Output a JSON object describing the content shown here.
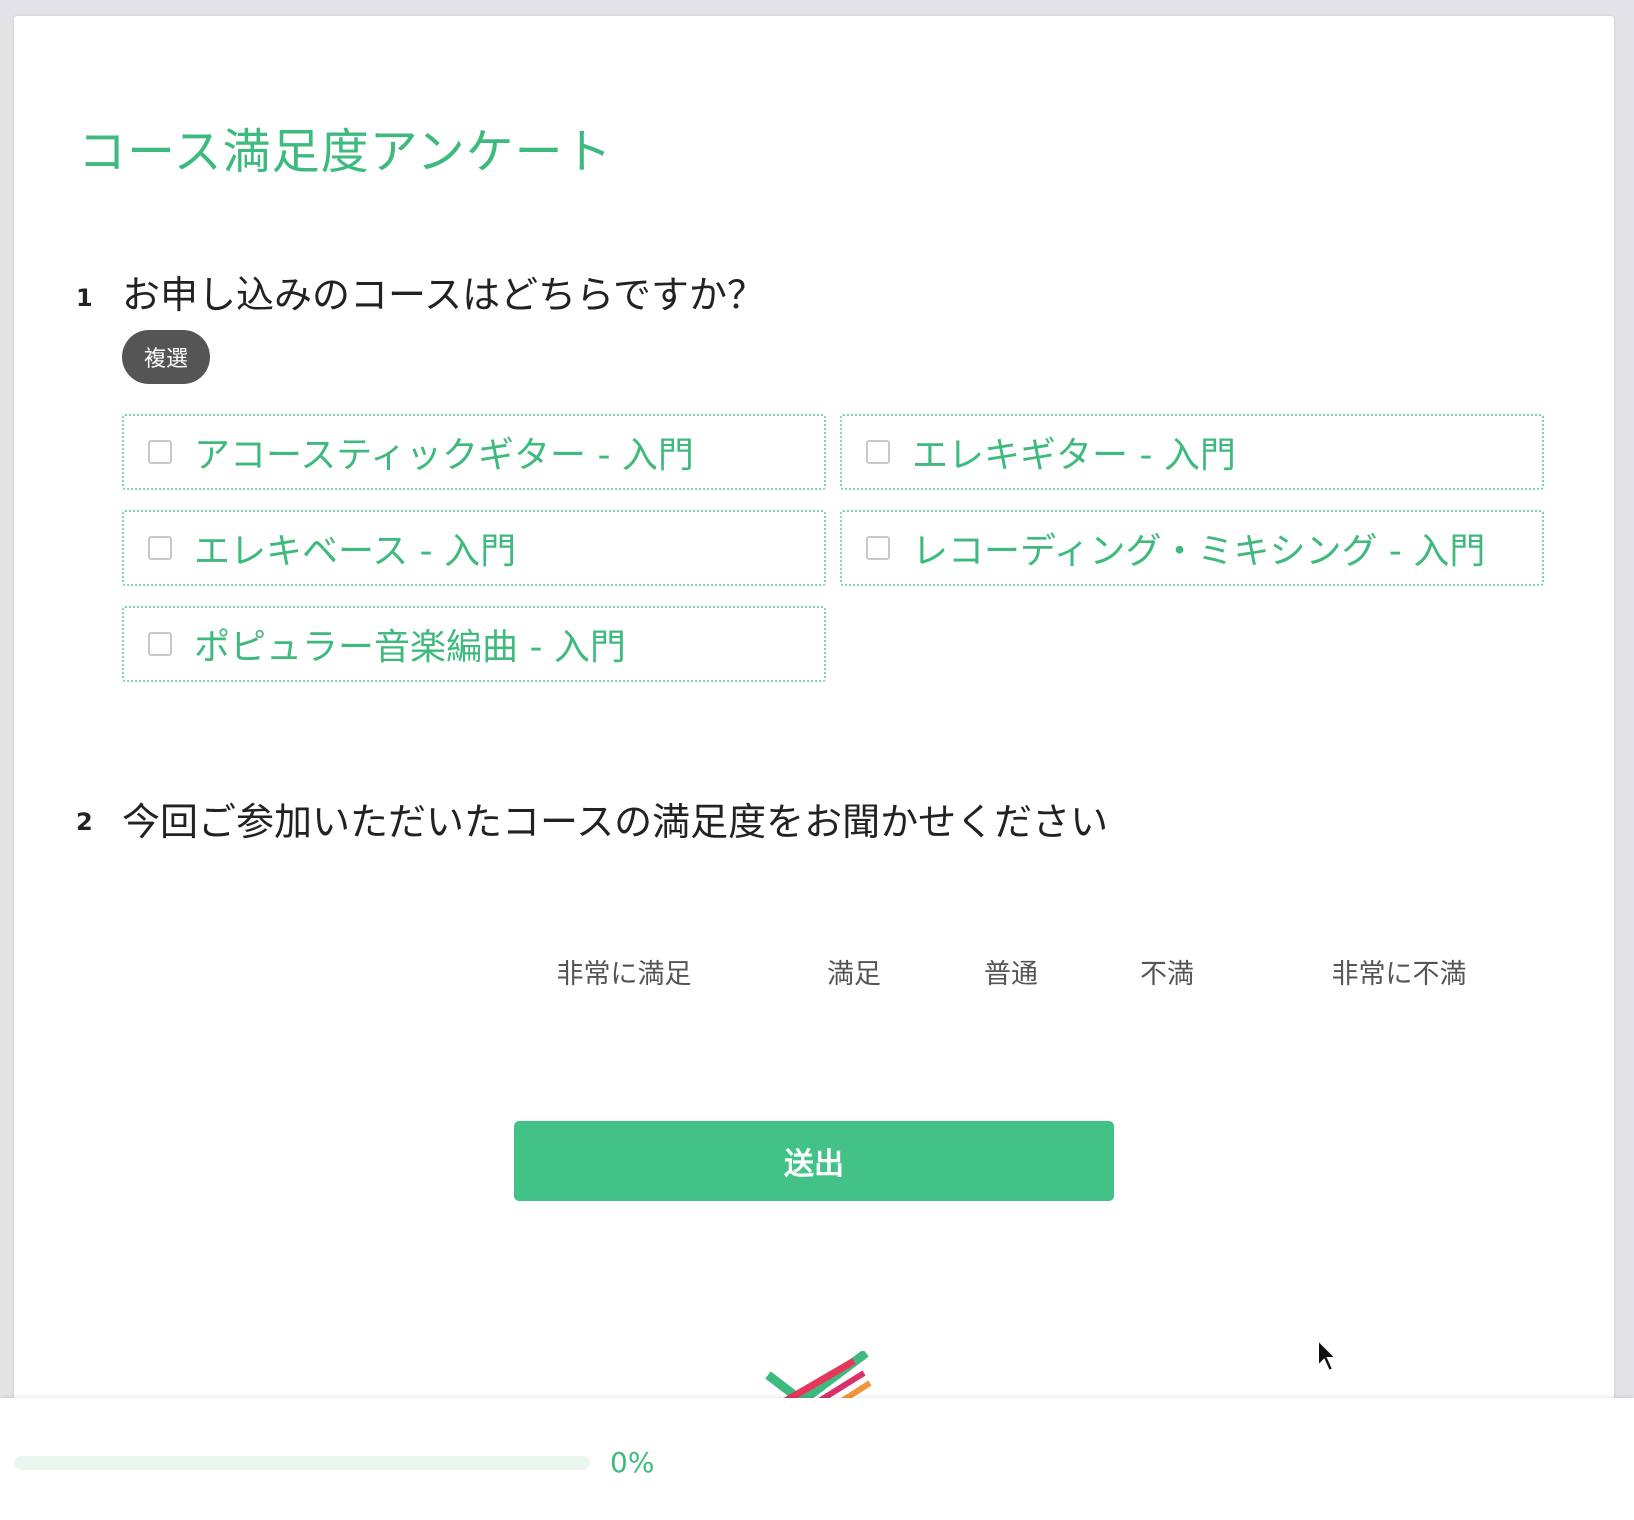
{
  "survey": {
    "title": "コース満足度アンケート"
  },
  "question1": {
    "number": "1",
    "text": "お申し込みのコースはどちらですか？",
    "badge": "複選",
    "options": [
      {
        "label": "アコースティックギター - 入門",
        "checked": false
      },
      {
        "label": "エレキギター - 入門",
        "checked": false
      },
      {
        "label": "エレキベース - 入門",
        "checked": false
      },
      {
        "label": "レコーディング・ミキシング - 入門",
        "checked": false
      },
      {
        "label": "ポピュラー音楽編曲 - 入門",
        "checked": false
      }
    ]
  },
  "question2": {
    "number": "2",
    "text": "今回ご参加いただいたコースの満足度をお聞かせください",
    "scale": [
      "非常に満足",
      "満足",
      "普通",
      "不満",
      "非常に不満"
    ]
  },
  "submit": {
    "label": "送出"
  },
  "progress": {
    "value": 0,
    "label": "0%"
  },
  "colors": {
    "accent": "#42c287",
    "accent_text": "#3fba7f",
    "badge": "#555555",
    "option_border": "#7fd3a9",
    "progress_track": "#e9f7f0"
  },
  "icons": {
    "logo": "checkmark-stripes-logo",
    "cursor": "mouse-pointer-icon"
  }
}
